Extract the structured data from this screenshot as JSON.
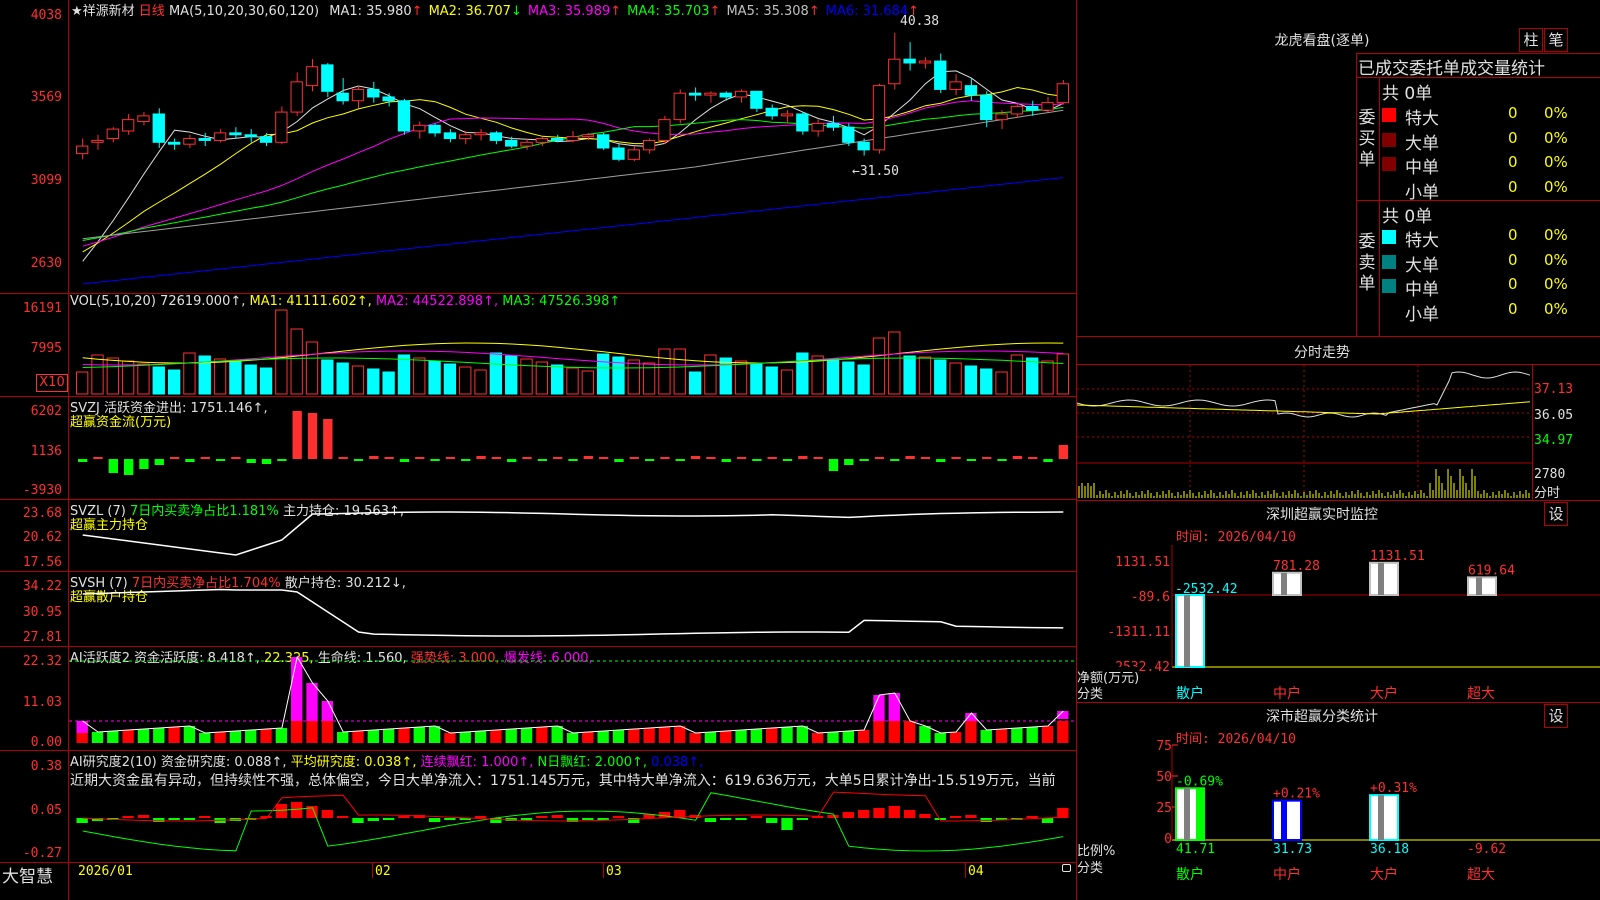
{
  "stock": {
    "name": "★祥源新材",
    "period": "日线",
    "ma_label": "MA(5,10,20,30,60,120)",
    "ma": [
      {
        "label": "MA1:",
        "value": "35.980",
        "arrow": "↑",
        "color": "#e0e0e0"
      },
      {
        "label": "MA2:",
        "value": "36.707",
        "arrow": "↓",
        "color": "#ffff00"
      },
      {
        "label": "MA3:",
        "value": "35.989",
        "arrow": "↑",
        "color": "#ff00ff"
      },
      {
        "label": "MA4:",
        "value": "35.703",
        "arrow": "↑",
        "color": "#00ff00"
      },
      {
        "label": "MA5:",
        "value": "35.308",
        "arrow": "↑",
        "color": "#c0c0c0"
      },
      {
        "label": "MA6:",
        "value": "31.684",
        "arrow": "↑",
        "color": "#0000ff"
      }
    ],
    "high_label": "40.38",
    "low_label": "←31.50"
  },
  "main_axis": [
    "4038",
    "3569",
    "3099",
    "2630"
  ],
  "vol": {
    "label": "VOL(5,10,20)",
    "value": "72619.000↑,",
    "ma1": "MA1: 41111.602↑,",
    "ma2": "MA2: 44522.898↑,",
    "ma3": "MA3: 47526.398↑",
    "axis": [
      "16191",
      "7995"
    ],
    "unit": "X10"
  },
  "svzj": {
    "label": "SVZJ  活跃资金进出: 1751.146↑,",
    "sub": "超赢资金流(万元)",
    "axis": [
      "6202",
      "1136",
      "-3930"
    ]
  },
  "svzl": {
    "label": "SVZL (7)",
    "desc": "7日内买卖净占比1.181%",
    "main": "主力持仓: 19.563↑,",
    "sub": "超赢主力持仓",
    "axis": [
      "23.68",
      "20.62",
      "17.56"
    ]
  },
  "svsh": {
    "label": "SVSH (7)",
    "desc": "7日内买卖净占比1.704%",
    "main": "散户持仓: 30.212↓,",
    "sub": "超赢散户持仓",
    "axis": [
      "34.22",
      "30.95",
      "27.81"
    ]
  },
  "ai1": {
    "label": "AI活跃度2 资金活跃度: 8.418↑,",
    "v2": "22.325,",
    "v3": "生命线: 1.560,",
    "v4": "强势线: 3.000,",
    "v5": "爆发线: 6.000,",
    "axis": [
      "22.32",
      "11.03",
      "0.00"
    ]
  },
  "ai2": {
    "label": "AI研究度2(10) 资金研究度: 0.088↑,",
    "v2": "平均研究度: 0.038↑,",
    "v3": "连续飘红: 1.000↑,",
    "v4": "N日飘红: 2.000↑,",
    "v5": "0.038↑,",
    "text": "近期大资金虽有异动，但持续性不强，总体偏空，今日大单净流入：1751.145万元，其中特大单净流入：619.636万元，大单5日累计净出-15.519万元，当前",
    "axis": [
      "0.38",
      "0.05",
      "-0.27"
    ]
  },
  "xaxis": [
    "2026/01",
    "02",
    "03",
    "04"
  ],
  "brand": "大智慧",
  "right": {
    "lhb_title": "龙虎看盘(逐单)",
    "btn_zhu": "柱",
    "btn_bi": "笔",
    "tabs": "已成交委托单成交量统计",
    "buy_side": "委买单",
    "sell_side": "委卖单",
    "buy_total": "共 0单",
    "sell_total": "共 0单",
    "rows": [
      {
        "name": "特大",
        "count": "0",
        "pct": "0%"
      },
      {
        "name": "大单",
        "count": "0",
        "pct": "0%"
      },
      {
        "name": "中单",
        "count": "0",
        "pct": "0%"
      },
      {
        "name": "小单",
        "count": "0",
        "pct": "0%"
      }
    ],
    "fs_title": "分时走势",
    "fs_axis": [
      "37.13",
      "36.05",
      "34.97",
      "2780",
      "分时"
    ],
    "sz_title": "深圳超赢实时监控",
    "sz_btn": "设",
    "sz_time": "时间: 2026/04/10",
    "sz_axis": [
      "1131.51",
      "-89.6",
      "-1311.11",
      "-2532.42"
    ],
    "sz_bars": [
      "-2532.42",
      "781.28",
      "1131.51",
      "619.64"
    ],
    "sz_ylabel": "净额(万元)",
    "sz_xlabel": "分类",
    "sz_cats": [
      "散户",
      "中户",
      "大户",
      "超大"
    ],
    "fl_title": "深市超赢分类统计",
    "fl_btn": "设",
    "fl_time": "时间: 2026/04/10",
    "fl_axis": [
      "75",
      "50",
      "25",
      "0"
    ],
    "fl_top": [
      "-0.69%",
      "+0.21%",
      "+0.31%"
    ],
    "fl_bottom": [
      "41.71",
      "31.73",
      "36.18",
      "-9.62"
    ],
    "fl_ylabel": "比例%",
    "fl_xlabel": "分类",
    "fl_cats": [
      "散户",
      "中户",
      "大户",
      "超大"
    ]
  },
  "chart_data": {
    "type": "candlestick",
    "title": "祥源新材 日线",
    "ylim": [
      26.3,
      40.38
    ],
    "candles": [
      [
        33.2,
        34.0,
        32.9,
        33.6
      ],
      [
        33.8,
        34.2,
        33.4,
        33.9
      ],
      [
        34.0,
        34.6,
        33.8,
        34.5
      ],
      [
        34.4,
        35.3,
        34.2,
        35.0
      ],
      [
        34.9,
        35.4,
        34.7,
        35.2
      ],
      [
        35.3,
        35.6,
        33.5,
        33.8
      ],
      [
        33.8,
        34.0,
        33.4,
        33.7
      ],
      [
        33.7,
        34.2,
        33.5,
        34.0
      ],
      [
        34.0,
        34.3,
        33.6,
        33.9
      ],
      [
        33.9,
        34.5,
        33.8,
        34.3
      ],
      [
        34.3,
        34.6,
        34.0,
        34.2
      ],
      [
        34.2,
        34.5,
        33.8,
        34.1
      ],
      [
        34.1,
        34.3,
        33.6,
        33.8
      ],
      [
        33.8,
        35.7,
        33.7,
        35.4
      ],
      [
        35.4,
        37.5,
        35.2,
        37.0
      ],
      [
        36.8,
        38.2,
        36.5,
        37.8
      ],
      [
        37.9,
        38.0,
        36.2,
        36.5
      ],
      [
        36.4,
        37.2,
        35.8,
        36.0
      ],
      [
        36.0,
        36.8,
        35.6,
        36.6
      ],
      [
        36.6,
        37.0,
        35.9,
        36.2
      ],
      [
        36.2,
        36.4,
        35.7,
        36.0
      ],
      [
        36.0,
        36.1,
        34.2,
        34.4
      ],
      [
        34.4,
        34.9,
        34.0,
        34.7
      ],
      [
        34.7,
        34.8,
        34.1,
        34.3
      ],
      [
        34.3,
        34.5,
        33.8,
        34.0
      ],
      [
        34.0,
        34.4,
        33.7,
        34.2
      ],
      [
        34.2,
        34.5,
        33.9,
        34.3
      ],
      [
        34.3,
        34.4,
        33.7,
        33.9
      ],
      [
        33.9,
        34.1,
        33.5,
        33.6
      ],
      [
        33.6,
        34.0,
        33.4,
        33.8
      ],
      [
        33.8,
        34.1,
        33.6,
        34.0
      ],
      [
        34.0,
        34.2,
        33.8,
        33.9
      ],
      [
        33.9,
        34.4,
        33.8,
        34.1
      ],
      [
        34.1,
        34.3,
        33.9,
        34.2
      ],
      [
        34.2,
        34.3,
        33.4,
        33.5
      ],
      [
        33.5,
        33.7,
        32.8,
        32.9
      ],
      [
        32.9,
        33.6,
        32.8,
        33.4
      ],
      [
        33.4,
        34.0,
        33.2,
        33.9
      ],
      [
        33.9,
        35.2,
        33.7,
        35.0
      ],
      [
        35.0,
        36.6,
        34.8,
        36.4
      ],
      [
        36.4,
        36.7,
        36.0,
        36.3
      ],
      [
        36.3,
        36.5,
        35.9,
        36.4
      ],
      [
        36.4,
        36.5,
        36.0,
        36.2
      ],
      [
        36.2,
        36.6,
        35.9,
        36.5
      ],
      [
        36.5,
        36.5,
        35.4,
        35.6
      ],
      [
        35.6,
        35.8,
        35.0,
        35.2
      ],
      [
        35.2,
        35.5,
        34.8,
        35.3
      ],
      [
        35.3,
        35.4,
        34.2,
        34.4
      ],
      [
        34.4,
        35.0,
        34.1,
        34.8
      ],
      [
        34.8,
        35.2,
        34.4,
        34.6
      ],
      [
        34.6,
        34.8,
        33.6,
        33.8
      ],
      [
        33.8,
        34.0,
        33.1,
        33.4
      ],
      [
        33.4,
        36.9,
        33.2,
        36.8
      ],
      [
        36.9,
        39.6,
        36.6,
        38.2
      ],
      [
        38.2,
        39.1,
        37.6,
        38.0
      ],
      [
        38.0,
        38.3,
        37.7,
        38.1
      ],
      [
        38.1,
        38.5,
        36.4,
        36.6
      ],
      [
        36.6,
        37.4,
        36.3,
        37.0
      ],
      [
        36.8,
        37.2,
        36.0,
        36.3
      ],
      [
        36.3,
        36.5,
        34.6,
        35.0
      ],
      [
        35.0,
        35.5,
        34.5,
        35.3
      ],
      [
        35.3,
        35.8,
        35.1,
        35.7
      ],
      [
        35.7,
        36.0,
        35.2,
        35.5
      ],
      [
        35.5,
        36.2,
        35.4,
        35.9
      ],
      [
        35.9,
        37.1,
        35.8,
        36.9
      ]
    ]
  }
}
